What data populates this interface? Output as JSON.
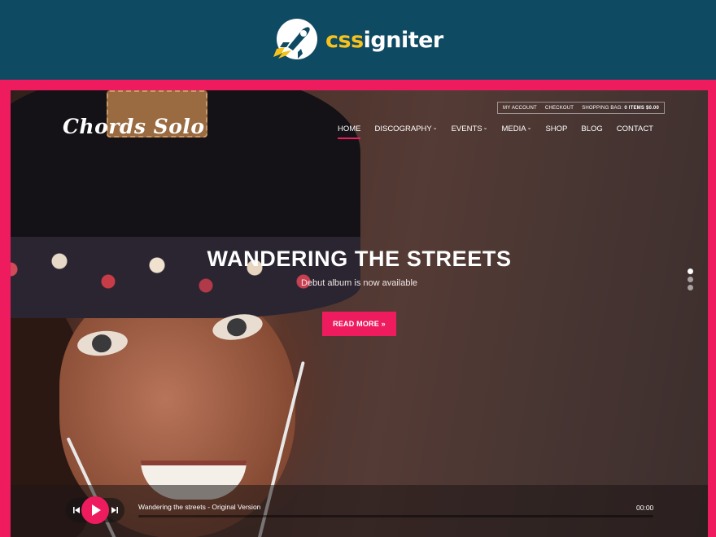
{
  "brand": {
    "prefix": "css",
    "suffix": "igniter",
    "logo_icon": "rocket-icon"
  },
  "site": {
    "logo": "Chords Solo"
  },
  "topbar": {
    "my_account": "MY ACCOUNT",
    "checkout": "CHECKOUT",
    "shopping_bag": "SHOPPING BAG:",
    "items": "0 ITEMS",
    "total": "$0.00"
  },
  "nav": {
    "items": [
      {
        "label": "HOME",
        "active": true
      },
      {
        "label": "DISCOGRAPHY",
        "dropdown": true
      },
      {
        "label": "EVENTS",
        "dropdown": true
      },
      {
        "label": "MEDIA",
        "dropdown": true
      },
      {
        "label": "SHOP"
      },
      {
        "label": "BLOG"
      },
      {
        "label": "CONTACT"
      }
    ],
    "caret": "⌄"
  },
  "hero": {
    "title": "WANDERING THE STREETS",
    "subtitle": "Debut album is now available",
    "button": "READ MORE »",
    "slides": 3,
    "active_slide": 1
  },
  "player": {
    "track": "Wandering the streets - Original Version",
    "time": "00:00",
    "progress": 0,
    "prev_icon": "skip-back-icon",
    "play_icon": "play-icon",
    "next_icon": "skip-forward-icon"
  },
  "colors": {
    "accent": "#ee1b5f",
    "header_bg": "#0f4a63",
    "brand_yellow": "#f6c21c"
  }
}
